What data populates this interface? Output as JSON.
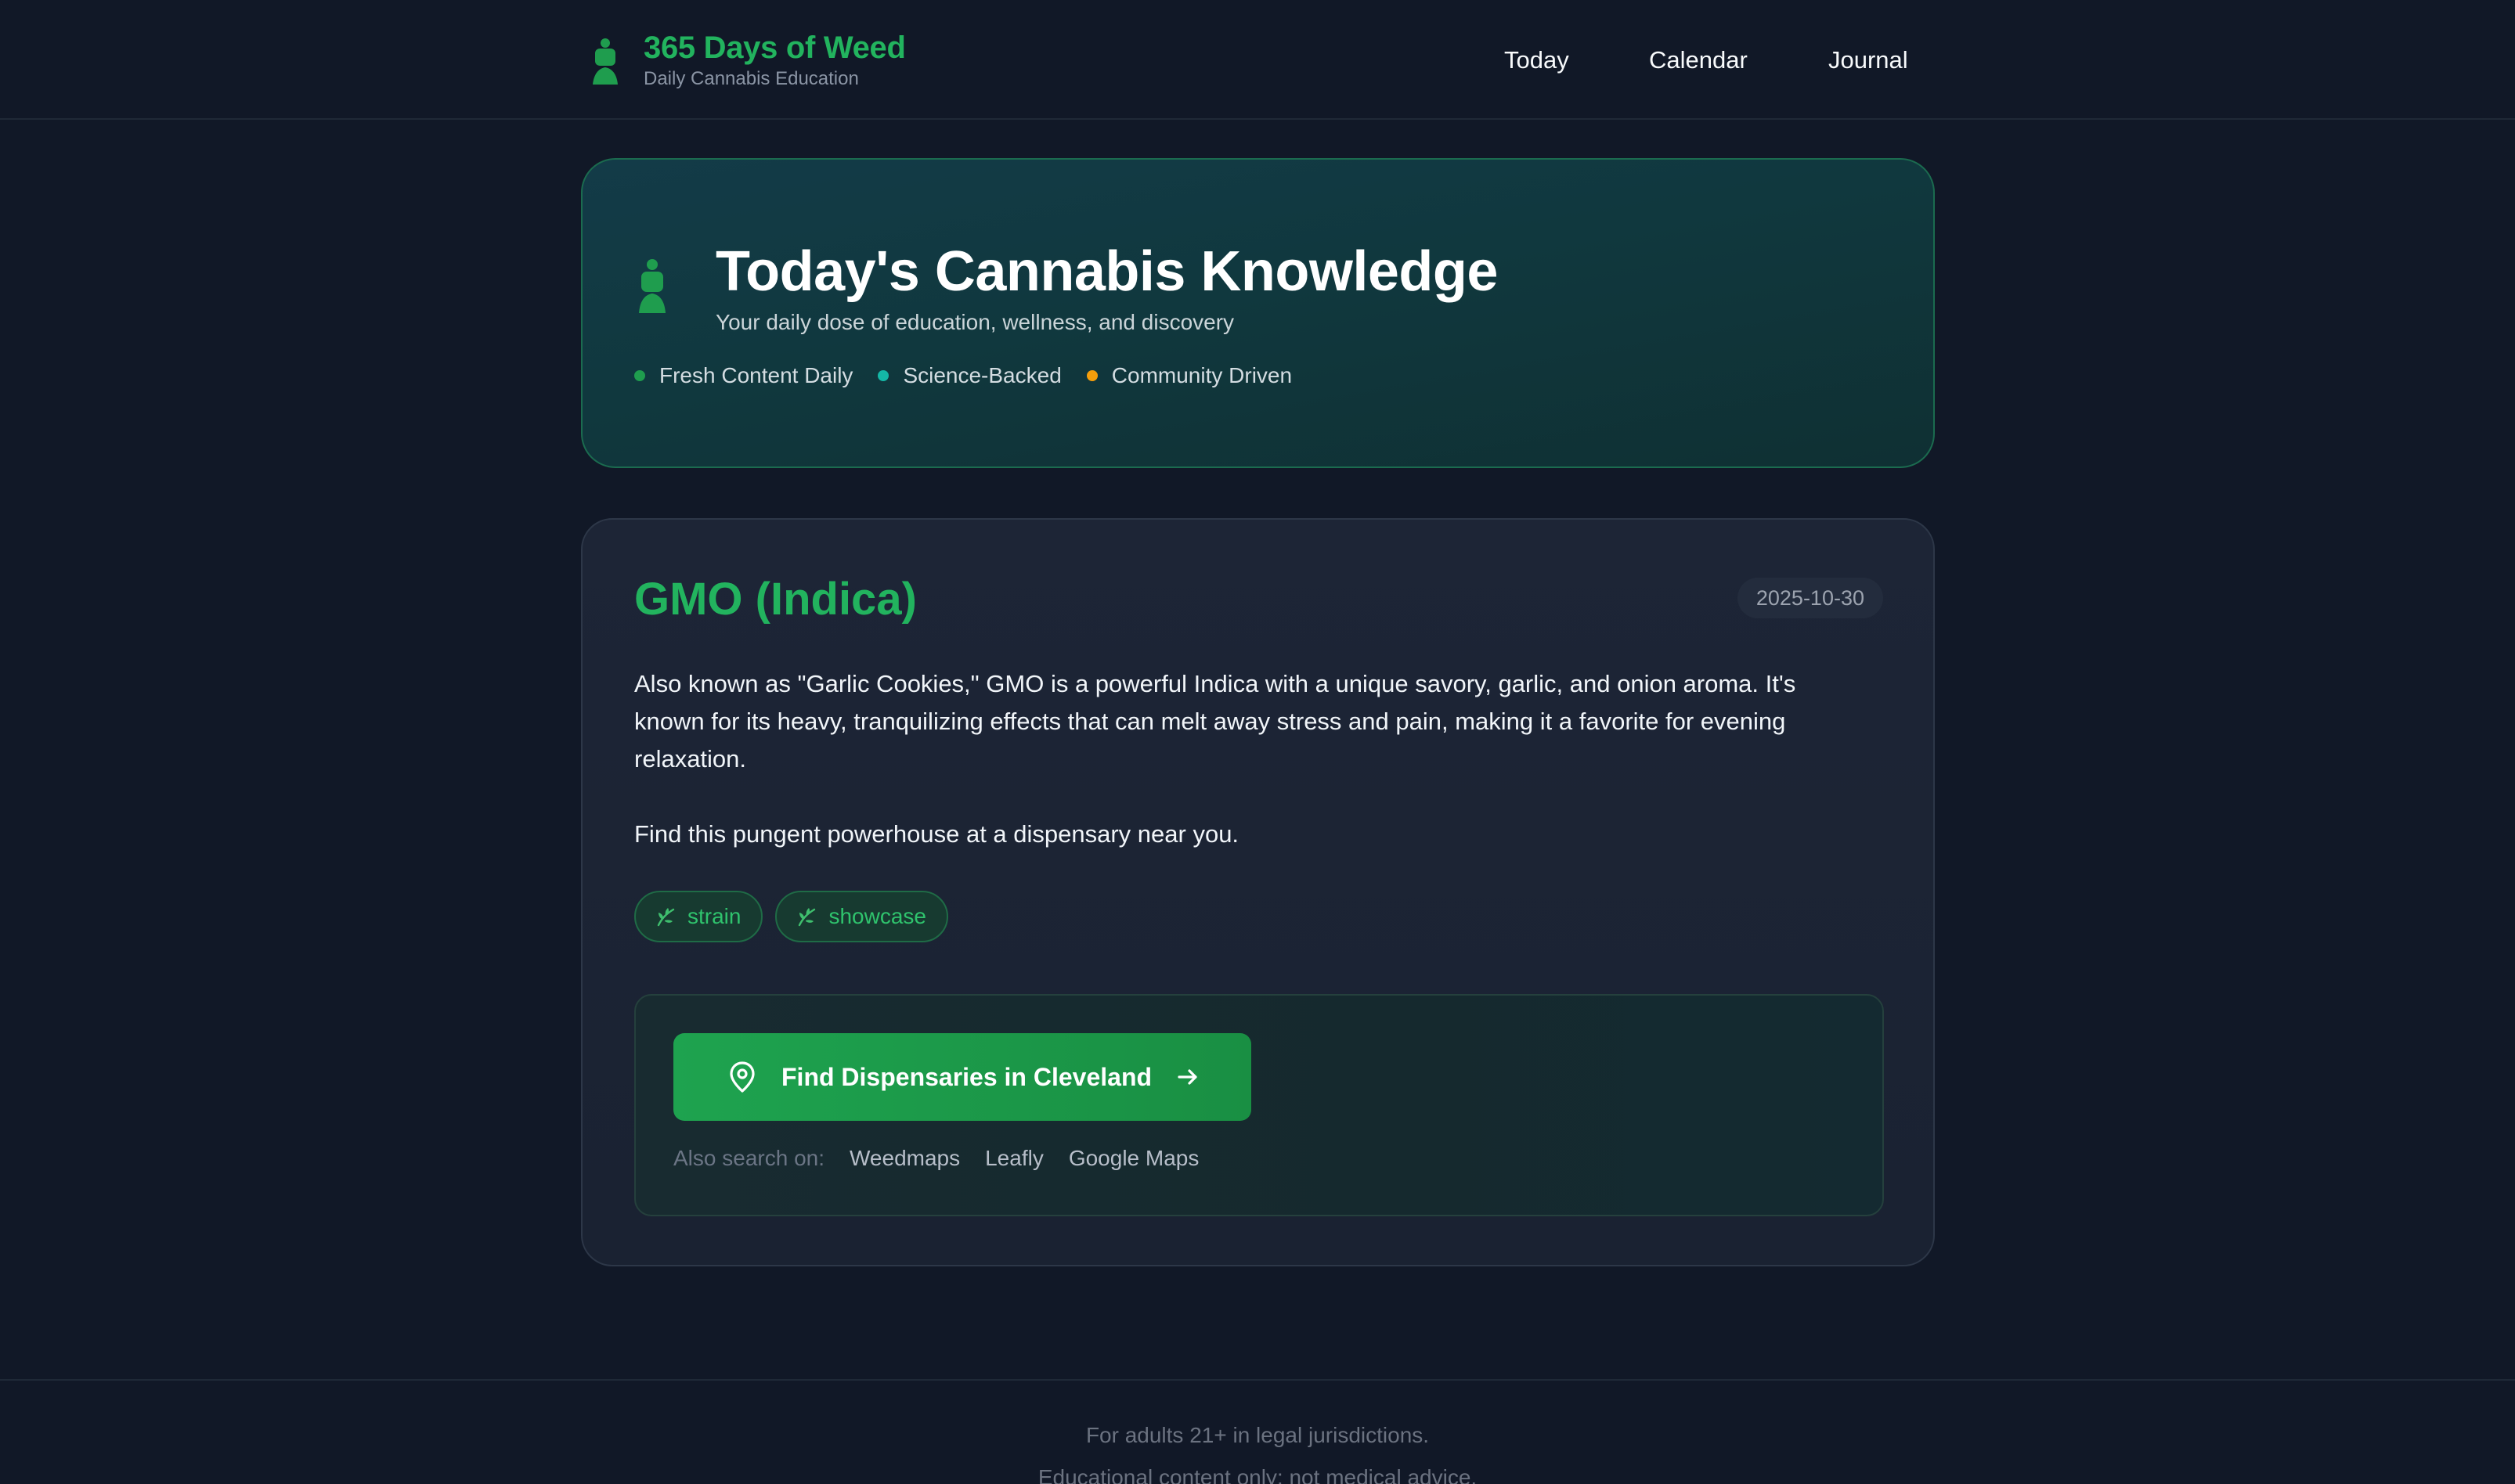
{
  "header": {
    "brand_title": "365 Days of Weed",
    "brand_subtitle": "Daily Cannabis Education",
    "nav": [
      {
        "label": "Today"
      },
      {
        "label": "Calendar"
      },
      {
        "label": "Journal"
      }
    ]
  },
  "hero": {
    "title": "Today's Cannabis Knowledge",
    "subtitle": "Your daily dose of education, wellness, and discovery",
    "features": [
      {
        "label": "Fresh Content Daily",
        "color": "#1f9d4e"
      },
      {
        "label": "Science-Backed",
        "color": "#14b8a6"
      },
      {
        "label": "Community Driven",
        "color": "#f59e0b"
      }
    ]
  },
  "entry": {
    "title": "GMO (Indica)",
    "date": "2025-10-30",
    "description_lines": [
      "Also known as \"Garlic Cookies,\" GMO is a powerful Indica with a unique savory, garlic, and onion aroma. It's",
      "known for its heavy, tranquilizing effects that can melt away stress and pain, making it a favorite for evening",
      "relaxation."
    ],
    "cta_text": "Find this pungent powerhouse at a dispensary near you.",
    "tags": [
      {
        "label": "strain",
        "icon": "leaf-icon"
      },
      {
        "label": "showcase",
        "icon": "leaf-icon"
      }
    ]
  },
  "finder": {
    "button_label": "Find Dispensaries in Cleveland",
    "also_label": "Also search on:",
    "links": [
      "Weedmaps",
      "Leafly",
      "Google Maps"
    ]
  },
  "footer": {
    "line1": "For adults 21+ in legal jurisdictions.",
    "line2": "Educational content only; not medical advice."
  },
  "colors": {
    "accent": "#22b35e",
    "background": "#111827",
    "card": "#1d2536"
  }
}
